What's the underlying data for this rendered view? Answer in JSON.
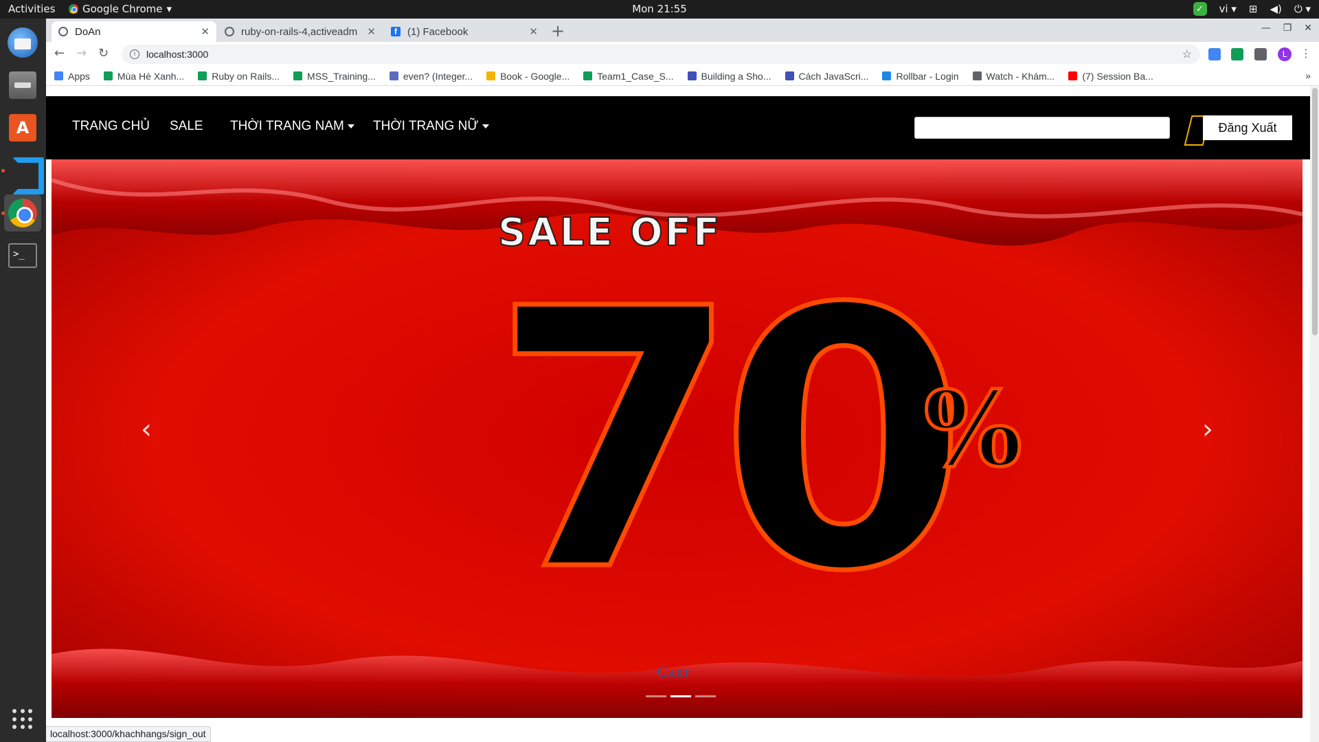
{
  "topbar": {
    "activities": "Activities",
    "app_name": "Google Chrome",
    "clock": "Mon 21:55",
    "lang": "vi"
  },
  "dock": [
    "thunderbird",
    "files",
    "software",
    "vscode",
    "chrome",
    "terminal"
  ],
  "tabs": [
    {
      "title": "DoAn",
      "active": true
    },
    {
      "title": "ruby-on-rails-4,activeadm",
      "active": false
    },
    {
      "title": "(1) Facebook",
      "active": false
    }
  ],
  "address_bar": {
    "url": "localhost:3000"
  },
  "bookmarks": [
    {
      "label": "Apps",
      "color": "#4285f4"
    },
    {
      "label": "Mùa Hè Xanh...",
      "color": "#0f9d58"
    },
    {
      "label": "Ruby on Rails...",
      "color": "#0f9d58"
    },
    {
      "label": "MSS_Training...",
      "color": "#0f9d58"
    },
    {
      "label": "even? (Integer...",
      "color": "#5c6bc0"
    },
    {
      "label": "Book - Google...",
      "color": "#f4b400"
    },
    {
      "label": "Team1_Case_S...",
      "color": "#0f9d58"
    },
    {
      "label": "Building a Sho...",
      "color": "#3f51b5"
    },
    {
      "label": "Cách JavaScri...",
      "color": "#3f51b5"
    },
    {
      "label": "Rollbar - Login",
      "color": "#1e88e5"
    },
    {
      "label": "Watch - Khám...",
      "color": "#5f6368"
    },
    {
      "label": "(7) Session Ba...",
      "color": "#ff0000"
    }
  ],
  "site": {
    "nav": {
      "home": "TRANG CHỦ",
      "sale": "SALE",
      "men": "THỜI TRANG NAM",
      "women": "THỜI TRANG NỮ"
    },
    "search_value": "",
    "logout": "Đăng Xuất"
  },
  "carousel": {
    "headline": "SALE OFF",
    "discount_number": "70",
    "percent": "%",
    "slide_count": 3,
    "active_slide": 2
  },
  "cart_heading": "Cart",
  "status_url": "localhost:3000/khachhangs/sign_out"
}
